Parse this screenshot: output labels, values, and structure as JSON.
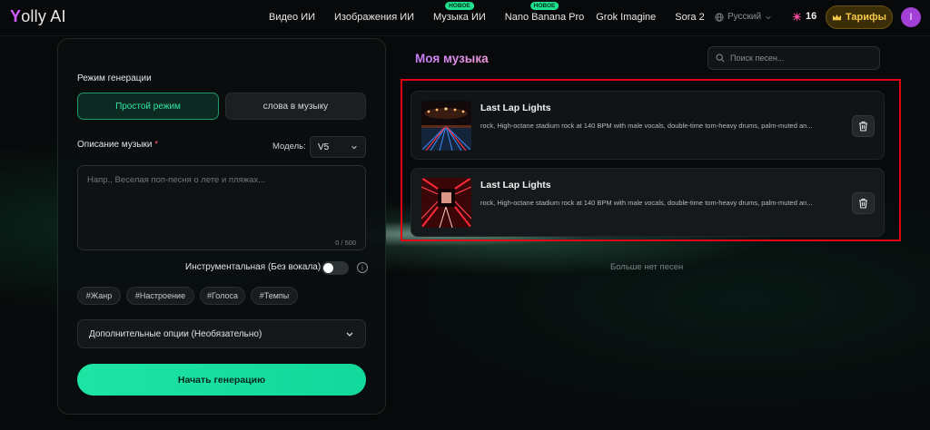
{
  "header": {
    "logo": "Yolly AI",
    "nav": [
      {
        "label": "Видео ИИ",
        "badge": ""
      },
      {
        "label": "Изображения ИИ",
        "badge": ""
      },
      {
        "label": "Музыка ИИ",
        "badge": "НОВОЕ"
      },
      {
        "label": "Nano Banana Pro",
        "badge": "НОВОЕ"
      },
      {
        "label": "Grok Imagine",
        "badge": ""
      },
      {
        "label": "Sora 2",
        "badge": ""
      }
    ],
    "language": "Русский",
    "credits": "16",
    "tariffs_label": "Тарифы",
    "avatar_letter": "I"
  },
  "form": {
    "mode_label": "Режим генерации",
    "mode_simple": "Простой режим",
    "mode_lyrics": "слова в музыку",
    "description_label": "Описание музыки",
    "required_mark": "*",
    "model_label": "Модель:",
    "model_value": "V5",
    "placeholder": "Напр., Веселая поп-песня о лете и пляжах...",
    "counter": "0 / 500",
    "instrumental_label": "Инструментальная (Без вокала)",
    "tags": [
      "#Жанр",
      "#Настроение",
      "#Голоса",
      "#Темпы"
    ],
    "advanced_label": "Дополнительные опции (Необязательно)",
    "generate_label": "Начать генерацию"
  },
  "library": {
    "title": "Моя музыка",
    "search_placeholder": "Поиск песен...",
    "songs": [
      {
        "title": "Last Lap Lights",
        "description": "rock, High-octane stadium rock at 140 BPM with male vocals, double-time tom-heavy drums, palm-muted an..."
      },
      {
        "title": "Last Lap Lights",
        "description": "rock, High-octane stadium rock at 140 BPM with male vocals, double-time tom-heavy drums, palm-muted an..."
      }
    ],
    "no_more": "Больше нет песен"
  },
  "colors": {
    "accent_green": "#1de4a2",
    "accent_purple": "#d35cff",
    "highlight_red": "#e00012",
    "tariff_gold": "#f5c84a"
  }
}
